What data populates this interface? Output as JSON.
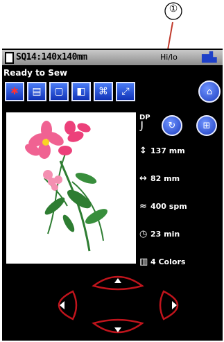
{
  "callout": {
    "label": "①"
  },
  "header": {
    "title": "SQ14:140x140mm",
    "speed_label": "Hi/lo",
    "machine_icon": "sewing-machine-icon"
  },
  "status": {
    "text": "Ready to Sew"
  },
  "toolbar": {
    "buttons": [
      {
        "icon": "trial-stitch-icon",
        "glyph": "✱"
      },
      {
        "icon": "color-list-icon",
        "glyph": "▤"
      },
      {
        "icon": "frame-trace-icon",
        "glyph": "▢"
      },
      {
        "icon": "cut-jump-icon",
        "glyph": "◧"
      },
      {
        "icon": "stitch-back-icon",
        "glyph": "⌘"
      },
      {
        "icon": "jump-stitch-icon",
        "glyph": "⤢"
      }
    ],
    "right_icon": "hoop-icon"
  },
  "side_buttons": {
    "dp_label": "DP",
    "dp_icon": "needle-position-icon",
    "left_icon": "rotate-icon",
    "right_icon": "grid-icon"
  },
  "info": {
    "height": "137 mm",
    "width": "82 mm",
    "speed": "400 spm",
    "time": "23 min",
    "colors": "4 Colors"
  },
  "colors": {
    "screen": "#000000",
    "button_blue": "#1e40c8",
    "dpad_red": "#c0141c",
    "stem": "#2e7d32",
    "petal": "#f06292"
  }
}
